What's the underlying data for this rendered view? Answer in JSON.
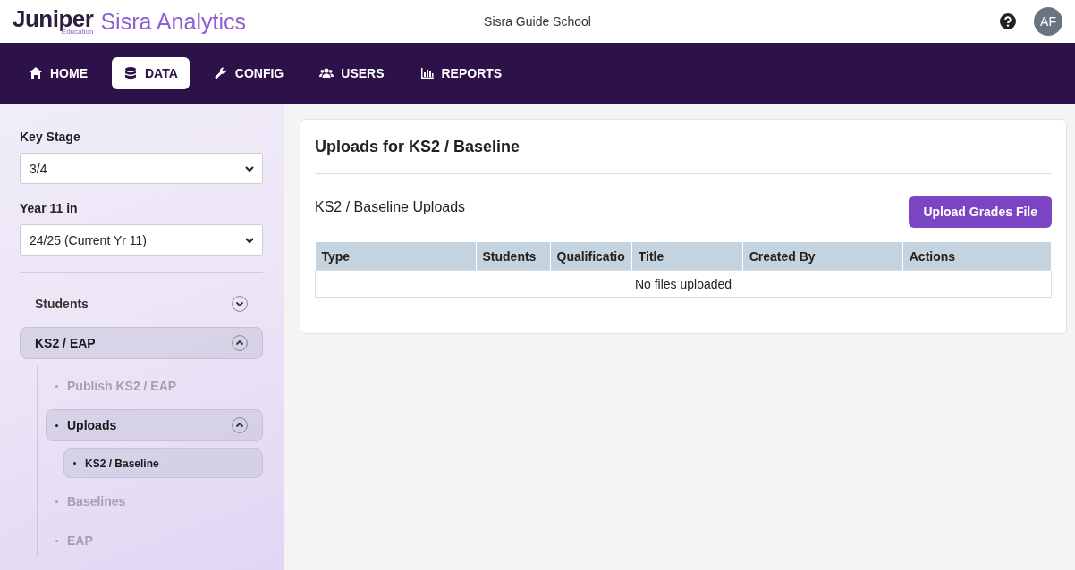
{
  "header": {
    "logo_main": "Juniper",
    "logo_sub": "Education",
    "product": "Sisra Analytics",
    "school": "Sisra Guide School",
    "avatar": "AF"
  },
  "nav": [
    {
      "label": "HOME",
      "kind": "home",
      "selected": false
    },
    {
      "label": "DATA",
      "kind": "database",
      "selected": true
    },
    {
      "label": "CONFIG",
      "kind": "wrench",
      "selected": false
    },
    {
      "label": "USERS",
      "kind": "users",
      "selected": false
    },
    {
      "label": "REPORTS",
      "kind": "chart",
      "selected": false
    }
  ],
  "sidebar": {
    "filters": [
      {
        "label": "Key Stage",
        "value": "3/4"
      },
      {
        "label": "Year 11 in",
        "value": "24/25 (Current Yr 11)"
      }
    ],
    "items": [
      {
        "label": "Students",
        "selected": false,
        "expanded": false
      },
      {
        "label": "KS2 / EAP",
        "selected": true,
        "expanded": true,
        "children": [
          {
            "label": "Publish KS2 / EAP",
            "selected": false
          },
          {
            "label": "Uploads",
            "selected": true,
            "expanded": true,
            "children": [
              {
                "label": "KS2 / Baseline",
                "selected": true
              }
            ]
          },
          {
            "label": "Baselines",
            "selected": false
          },
          {
            "label": "EAP",
            "selected": false
          }
        ]
      }
    ]
  },
  "main": {
    "title": "Uploads for KS2 / Baseline",
    "section_title": "KS2 / Baseline Uploads",
    "upload_button": "Upload Grades File",
    "table": {
      "columns": [
        "Type",
        "Students",
        "Qualificatio",
        "Title",
        "Created By",
        "Actions"
      ],
      "empty_message": "No files uploaded"
    }
  }
}
